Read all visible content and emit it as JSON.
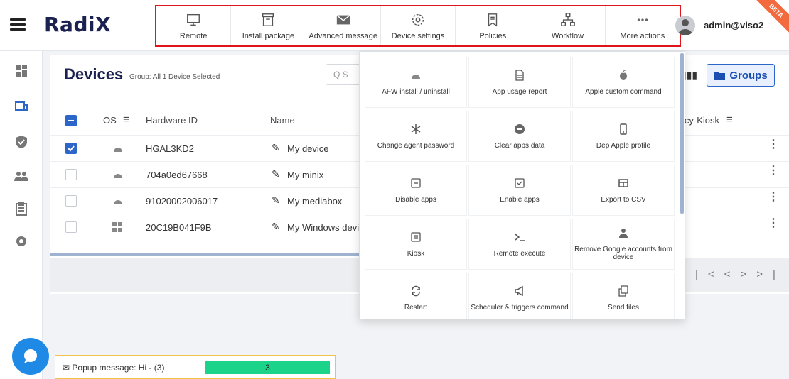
{
  "brand": {
    "logo": "RadiX",
    "beta": "BETA"
  },
  "toolbar": {
    "items": [
      {
        "label": "Remote",
        "icon": "monitor-icon"
      },
      {
        "label": "Install package",
        "icon": "package-icon"
      },
      {
        "label": "Advanced message",
        "icon": "envelope-icon"
      },
      {
        "label": "Device settings",
        "icon": "gear-icon"
      },
      {
        "label": "Policies",
        "icon": "flag-icon"
      },
      {
        "label": "Workflow",
        "icon": "sitemap-icon"
      },
      {
        "label": "More actions",
        "icon": "more-icon"
      }
    ]
  },
  "user": {
    "name": "admin@viso2"
  },
  "page": {
    "title": "Devices",
    "subinfo": "Group: All  1 Device Selected",
    "search_placeholder": "Q  S",
    "groups_label": "Groups"
  },
  "table": {
    "headers": {
      "os": "OS",
      "hardware": "Hardware ID",
      "name": "Name",
      "policy": "icy-Kiosk"
    },
    "rows": [
      {
        "checked": true,
        "os": "android",
        "hardware": "HGAL3KD2",
        "name": "My device"
      },
      {
        "checked": false,
        "os": "android",
        "hardware": "704a0ed67668",
        "name": "My minix"
      },
      {
        "checked": false,
        "os": "android",
        "hardware": "91020002006017",
        "name": "My mediabox"
      },
      {
        "checked": false,
        "os": "windows",
        "hardware": "20C19B041F9B",
        "name": "My Windows devic"
      }
    ]
  },
  "menu": {
    "items": [
      {
        "label": "AFW install / uninstall",
        "icon": "android-icon"
      },
      {
        "label": "App usage report",
        "icon": "report-icon"
      },
      {
        "label": "Apple custom command",
        "icon": "apple-icon"
      },
      {
        "label": "Change agent password",
        "icon": "asterisk-icon"
      },
      {
        "label": "Clear apps data",
        "icon": "minus-circle-icon"
      },
      {
        "label": "Dep Apple profile",
        "icon": "phone-icon"
      },
      {
        "label": "Disable apps",
        "icon": "minus-square-icon"
      },
      {
        "label": "Enable apps",
        "icon": "check-square-icon"
      },
      {
        "label": "Export to CSV",
        "icon": "table-icon"
      },
      {
        "label": "Kiosk",
        "icon": "list-icon"
      },
      {
        "label": "Remote execute",
        "icon": "terminal-icon"
      },
      {
        "label": "Remove Google accounts from device",
        "icon": "user-icon"
      },
      {
        "label": "Restart",
        "icon": "refresh-icon"
      },
      {
        "label": "Scheduler & triggers command",
        "icon": "megaphone-icon"
      },
      {
        "label": "Send files",
        "icon": "copy-icon"
      }
    ]
  },
  "pager": {
    "first": "|<",
    "prev": "<",
    "next": ">",
    "last": ">|"
  },
  "popup": {
    "text": "Popup message: Hi  - (3)",
    "count": "3",
    "progress": 1.0
  },
  "colors": {
    "brand": "#1b2150",
    "accent": "#2b66c8",
    "toolbar_border": "#e0151b",
    "progress": "#1bd48a"
  }
}
